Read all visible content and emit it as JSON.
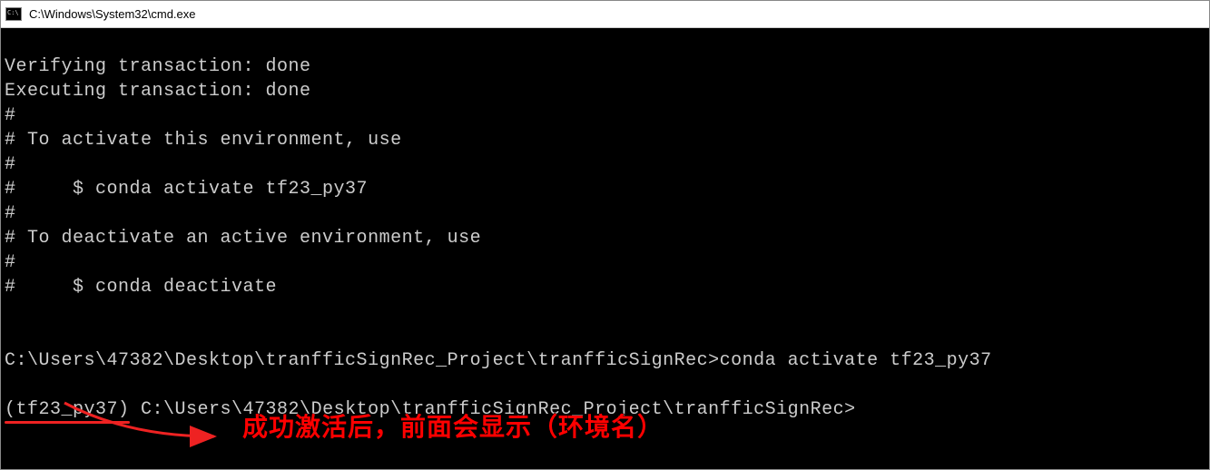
{
  "titlebar": {
    "title": "C:\\Windows\\System32\\cmd.exe"
  },
  "terminal": {
    "lines": [
      "Verifying transaction: done",
      "Executing transaction: done",
      "#",
      "# To activate this environment, use",
      "#",
      "#     $ conda activate tf23_py37",
      "#",
      "# To deactivate an active environment, use",
      "#",
      "#     $ conda deactivate",
      "",
      "",
      "C:\\Users\\47382\\Desktop\\tranfficSignRec_Project\\tranfficSignRec>conda activate tf23_py37",
      ""
    ],
    "env_prefix": "(tf23_py37)",
    "post_env_prompt": " C:\\Users\\47382\\Desktop\\tranfficSignRec_Project\\tranfficSignRec>"
  },
  "annotation": {
    "text": "成功激活后，前面会显示（环境名）"
  }
}
